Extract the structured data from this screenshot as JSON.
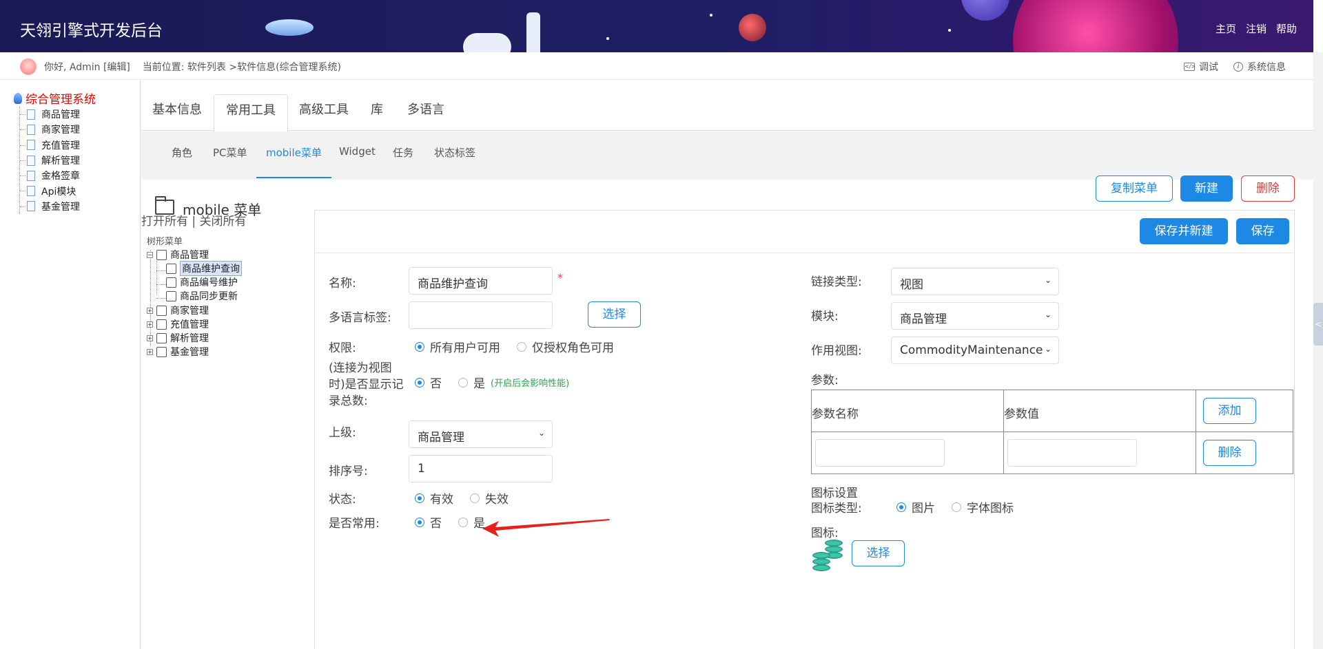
{
  "header": {
    "title": "天翎引擎式开发后台",
    "nav": [
      "主页",
      "注销",
      "帮助"
    ]
  },
  "subbar": {
    "greeting": "你好, Admin [编辑]",
    "breadcrumb": "当前位置: 软件列表 >软件信息(综合管理系统)",
    "debug": "调试",
    "sysinfo": "系统信息"
  },
  "sidebar": {
    "root": "综合管理系统",
    "items": [
      "商品管理",
      "商家管理",
      "充值管理",
      "解析管理",
      "金格签章",
      "Api模块",
      "基金管理"
    ]
  },
  "tabs": [
    "基本信息",
    "常用工具",
    "高级工具",
    "库",
    "多语言"
  ],
  "subtabs": [
    "角色",
    "PC菜单",
    "mobile菜单",
    "Widget",
    "任务",
    "状态标签"
  ],
  "page": {
    "title": "mobile 菜单",
    "copy_btn": "复制菜单",
    "new_btn": "新建",
    "delete_btn": "删除"
  },
  "tree": {
    "open_all": "打开所有",
    "sep": " | ",
    "close_all": "关闭所有",
    "head": "树形菜单",
    "nodes": [
      {
        "label": "商品管理",
        "exp": "−"
      },
      {
        "label": "商品维护查询"
      },
      {
        "label": "商品编号维护"
      },
      {
        "label": "商品同步更新"
      },
      {
        "label": "商家管理",
        "exp": "+"
      },
      {
        "label": "充值管理",
        "exp": "+"
      },
      {
        "label": "解析管理",
        "exp": "+"
      },
      {
        "label": "基金管理",
        "exp": "+"
      }
    ]
  },
  "form": {
    "save_new_btn": "保存并新建",
    "save_btn": "保存",
    "name_label": "名称:",
    "name_value": "商品维护查询",
    "required_mark": "*",
    "i18n_label": "多语言标签:",
    "choose_btn": "选择",
    "perm_label": "权限:",
    "perm_opts": [
      "所有用户可用",
      "仅授权角色可用"
    ],
    "count_label": "(连接为视图时)是否显示记录总数:",
    "no": "否",
    "yes": "是",
    "count_note": "(开启后会影响性能)",
    "parent_label": "上级:",
    "parent_value": "商品管理",
    "order_label": "排序号:",
    "order_value": "1",
    "status_label": "状态:",
    "status_opts": [
      "有效",
      "失效"
    ],
    "common_label": "是否常用:",
    "link_label": "链接类型:",
    "link_value": "视图",
    "module_label": "模块:",
    "module_value": "商品管理",
    "view_label": "作用视图:",
    "view_value": "CommodityMaintenance",
    "params_label": "参数:",
    "param_name_col": "参数名称",
    "param_value_col": "参数值",
    "add_btn": "添加",
    "row_delete_btn": "删除",
    "icon_settings": "图标设置",
    "icon_type_label": "图标类型:",
    "icon_type_opts": [
      "图片",
      "字体图标"
    ],
    "icon_label": "图标:",
    "icon_choose_btn": "选择"
  },
  "colors": {
    "accent": "#1e88e5",
    "danger": "#e53935",
    "header_bg": "#1f1f66",
    "note_green": "#2ea34a"
  }
}
